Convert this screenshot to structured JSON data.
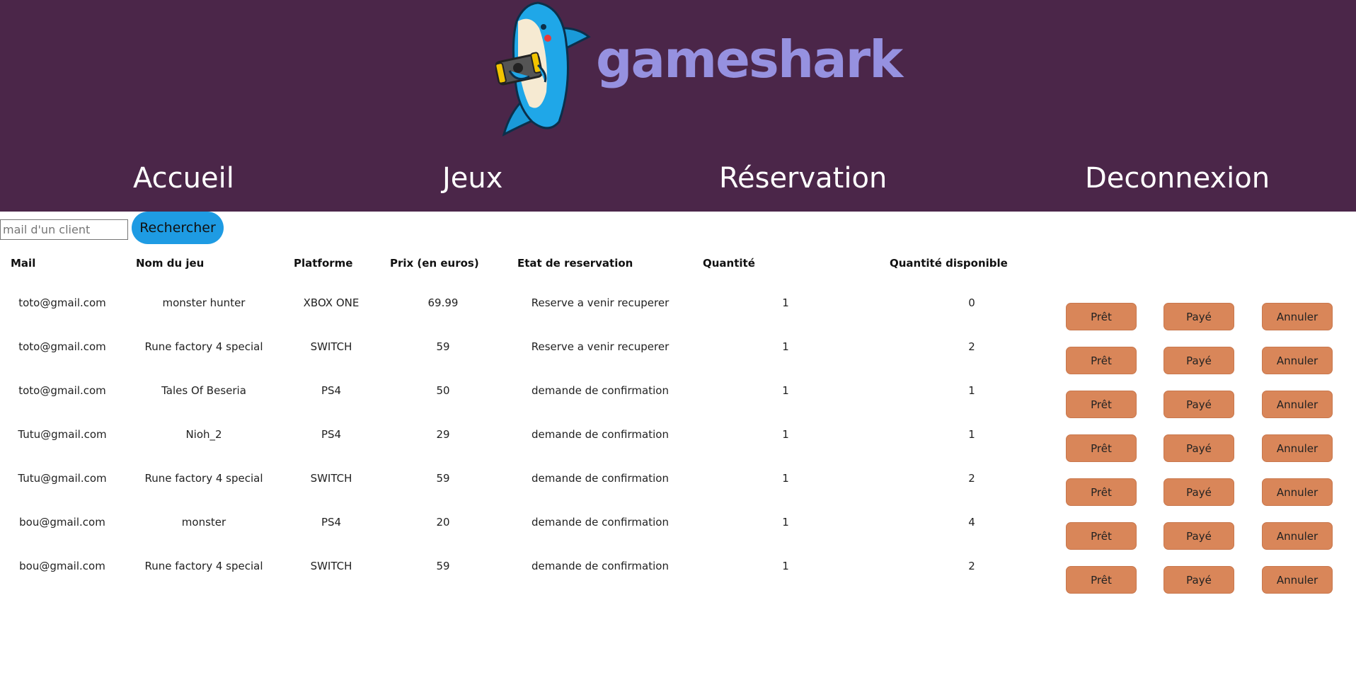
{
  "brand": {
    "name": "gameshark",
    "logo_icon": "shark-with-console-icon",
    "text_color": "#9691e0"
  },
  "colors": {
    "header_bg": "#4b2649",
    "search_button": "#1e9be3",
    "action_button": "#d98659"
  },
  "nav": {
    "items": [
      {
        "label": "Accueil"
      },
      {
        "label": "Jeux"
      },
      {
        "label": "Réservation"
      },
      {
        "label": "Deconnexion"
      }
    ]
  },
  "search": {
    "placeholder": "mail d'un client",
    "value": "",
    "button_label": "Rechercher"
  },
  "table": {
    "columns": [
      "Mail",
      "Nom du jeu",
      "Platforme",
      "Prix (en euros)",
      "Etat de reservation",
      "Quantité",
      "Quantité disponible"
    ],
    "actions": [
      "Prêt",
      "Payé",
      "Annuler"
    ],
    "rows": [
      {
        "mail": "toto@gmail.com",
        "jeu": "monster hunter",
        "platforme": "XBOX ONE",
        "prix": "69.99",
        "etat": "Reserve a venir recuperer",
        "quantite": "1",
        "disponible": "0"
      },
      {
        "mail": "toto@gmail.com",
        "jeu": "Rune factory 4 special",
        "platforme": "SWITCH",
        "prix": "59",
        "etat": "Reserve a venir recuperer",
        "quantite": "1",
        "disponible": "2"
      },
      {
        "mail": "toto@gmail.com",
        "jeu": "Tales Of Beseria",
        "platforme": "PS4",
        "prix": "50",
        "etat": "demande de confirmation",
        "quantite": "1",
        "disponible": "1"
      },
      {
        "mail": "Tutu@gmail.com",
        "jeu": "Nioh_2",
        "platforme": "PS4",
        "prix": "29",
        "etat": "demande de confirmation",
        "quantite": "1",
        "disponible": "1"
      },
      {
        "mail": "Tutu@gmail.com",
        "jeu": "Rune factory 4 special",
        "platforme": "SWITCH",
        "prix": "59",
        "etat": "demande de confirmation",
        "quantite": "1",
        "disponible": "2"
      },
      {
        "mail": "bou@gmail.com",
        "jeu": "monster",
        "platforme": "PS4",
        "prix": "20",
        "etat": "demande de confirmation",
        "quantite": "1",
        "disponible": "4"
      },
      {
        "mail": "bou@gmail.com",
        "jeu": "Rune factory 4 special",
        "platforme": "SWITCH",
        "prix": "59",
        "etat": "demande de confirmation",
        "quantite": "1",
        "disponible": "2"
      }
    ]
  }
}
